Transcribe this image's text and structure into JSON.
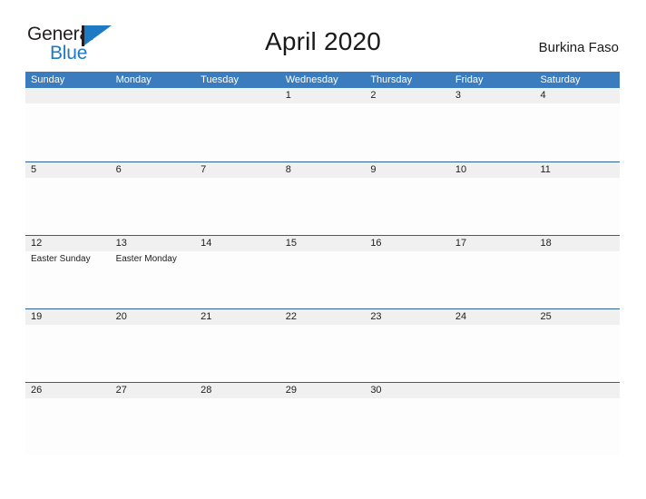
{
  "brand": {
    "name_part1": "General",
    "name_part2": "Blue",
    "mark_icon": "blue-flag-triangle-icon"
  },
  "header": {
    "title": "April 2020",
    "country": "Burkina Faso"
  },
  "colors": {
    "header_blue": "#3a7cbd",
    "row_line_blue": "#2a6196",
    "day_band_gray": "#f0f0f0",
    "brand_blue": "#1e7ac4",
    "text_dark": "#202020"
  },
  "calendar": {
    "weekdays": [
      "Sunday",
      "Monday",
      "Tuesday",
      "Wednesday",
      "Thursday",
      "Friday",
      "Saturday"
    ],
    "weeks": [
      [
        {
          "day": "",
          "event": ""
        },
        {
          "day": "",
          "event": ""
        },
        {
          "day": "",
          "event": ""
        },
        {
          "day": "1",
          "event": ""
        },
        {
          "day": "2",
          "event": ""
        },
        {
          "day": "3",
          "event": ""
        },
        {
          "day": "4",
          "event": ""
        }
      ],
      [
        {
          "day": "5",
          "event": ""
        },
        {
          "day": "6",
          "event": ""
        },
        {
          "day": "7",
          "event": ""
        },
        {
          "day": "8",
          "event": ""
        },
        {
          "day": "9",
          "event": ""
        },
        {
          "day": "10",
          "event": ""
        },
        {
          "day": "11",
          "event": ""
        }
      ],
      [
        {
          "day": "12",
          "event": "Easter Sunday"
        },
        {
          "day": "13",
          "event": "Easter Monday"
        },
        {
          "day": "14",
          "event": ""
        },
        {
          "day": "15",
          "event": ""
        },
        {
          "day": "16",
          "event": ""
        },
        {
          "day": "17",
          "event": ""
        },
        {
          "day": "18",
          "event": ""
        }
      ],
      [
        {
          "day": "19",
          "event": ""
        },
        {
          "day": "20",
          "event": ""
        },
        {
          "day": "21",
          "event": ""
        },
        {
          "day": "22",
          "event": ""
        },
        {
          "day": "23",
          "event": ""
        },
        {
          "day": "24",
          "event": ""
        },
        {
          "day": "25",
          "event": ""
        }
      ],
      [
        {
          "day": "26",
          "event": ""
        },
        {
          "day": "27",
          "event": ""
        },
        {
          "day": "28",
          "event": ""
        },
        {
          "day": "29",
          "event": ""
        },
        {
          "day": "30",
          "event": ""
        },
        {
          "day": "",
          "event": ""
        },
        {
          "day": "",
          "event": ""
        }
      ]
    ]
  }
}
